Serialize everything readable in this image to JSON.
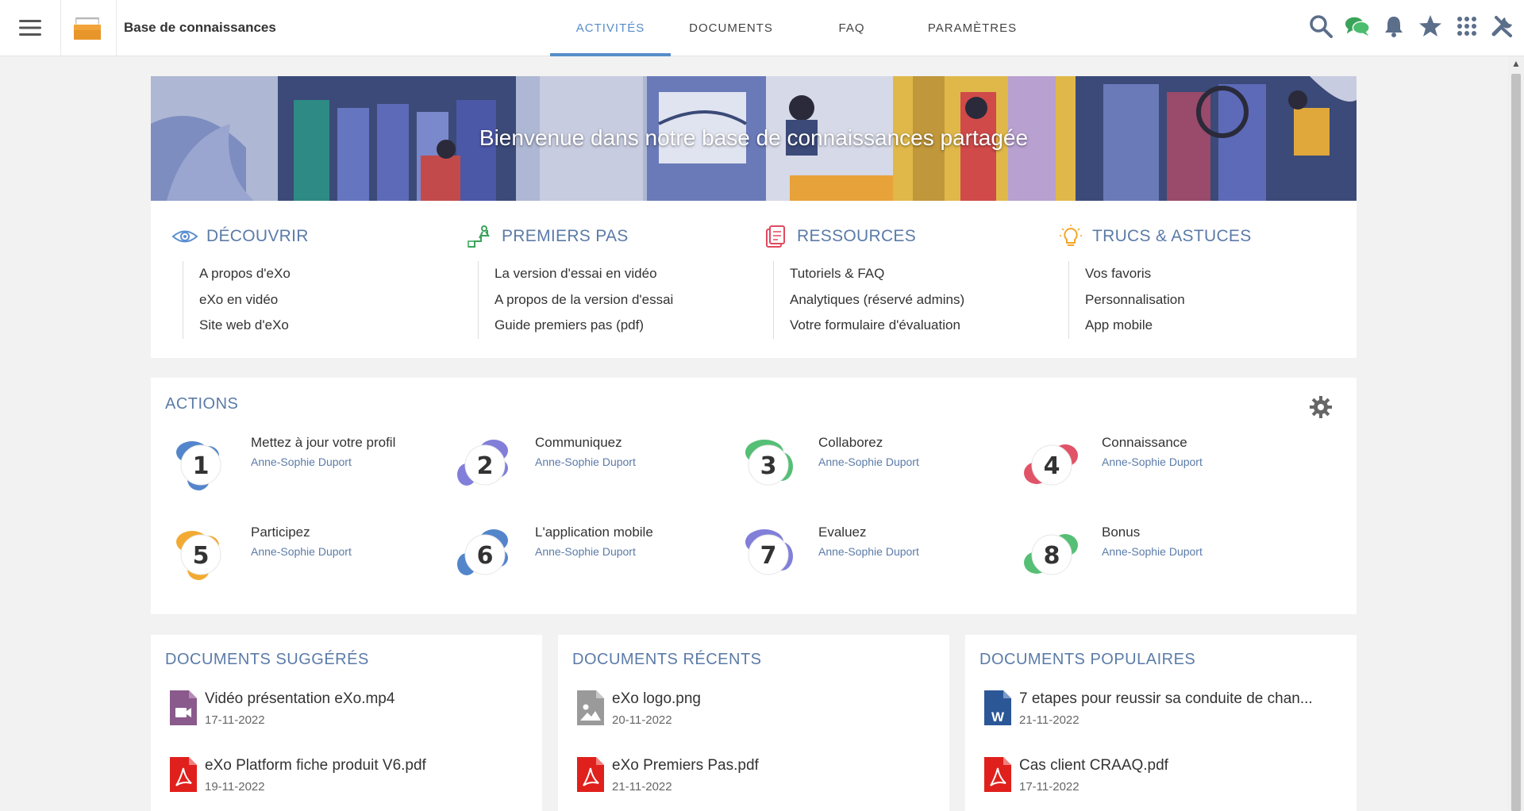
{
  "app": {
    "space_title": "Base de connaissances"
  },
  "tabs": [
    {
      "label": "ACTIVITÉS",
      "active": true
    },
    {
      "label": "DOCUMENTS",
      "active": false
    },
    {
      "label": "FAQ",
      "active": false
    },
    {
      "label": "PARAMÈTRES",
      "active": false
    }
  ],
  "top_icons": [
    "search-icon",
    "chat-icon",
    "bell-icon",
    "star-icon",
    "apps-grid-icon",
    "tools-icon"
  ],
  "banner": {
    "title": "Bienvenue dans notre base de connaissances partagée"
  },
  "link_columns": [
    {
      "title": "DÉCOUVRIR",
      "icon": "eye-icon",
      "items": [
        "A propos d'eXo",
        "eXo en vidéo",
        "Site web d'eXo"
      ]
    },
    {
      "title": "PREMIERS PAS",
      "icon": "steps-icon",
      "items": [
        "La version d'essai en vidéo",
        "A propos de la version d'essai",
        "Guide premiers pas (pdf)"
      ]
    },
    {
      "title": "RESSOURCES",
      "icon": "resources-icon",
      "items": [
        "Tutoriels & FAQ",
        "Analytiques (réservé admins)",
        "Votre formulaire d'évaluation"
      ]
    },
    {
      "title": "TRUCS & ASTUCES",
      "icon": "lightbulb-icon",
      "items": [
        "Vos favoris",
        "Personnalisation",
        "App mobile"
      ]
    }
  ],
  "actions": {
    "title": "ACTIONS",
    "items": [
      {
        "number": "1",
        "title": "Mettez à jour votre profil",
        "author": "Anne-Sophie Duport",
        "color": "#4a7fc9"
      },
      {
        "number": "2",
        "title": "Communiquez",
        "author": "Anne-Sophie Duport",
        "color": "#7b79d8"
      },
      {
        "number": "3",
        "title": "Collaborez",
        "author": "Anne-Sophie Duport",
        "color": "#4cbc6e"
      },
      {
        "number": "4",
        "title": "Connaissance",
        "author": "Anne-Sophie Duport",
        "color": "#e04a5f"
      },
      {
        "number": "5",
        "title": "Participez",
        "author": "Anne-Sophie Duport",
        "color": "#f2a628"
      },
      {
        "number": "6",
        "title": "L'application mobile",
        "author": "Anne-Sophie Duport",
        "color": "#4a7fc9"
      },
      {
        "number": "7",
        "title": "Evaluez",
        "author": "Anne-Sophie Duport",
        "color": "#7b79d8"
      },
      {
        "number": "8",
        "title": "Bonus",
        "author": "Anne-Sophie Duport",
        "color": "#4cbc6e"
      }
    ]
  },
  "documents": [
    {
      "title": "DOCUMENTS SUGGÉRÉS",
      "items": [
        {
          "name": "Vidéo présentation eXo.mp4",
          "date": "17-11-2022",
          "type": "video"
        },
        {
          "name": "eXo Platform fiche produit V6.pdf",
          "date": "19-11-2022",
          "type": "pdf"
        }
      ]
    },
    {
      "title": "DOCUMENTS RÉCENTS",
      "items": [
        {
          "name": "eXo logo.png",
          "date": "20-11-2022",
          "type": "image"
        },
        {
          "name": "eXo Premiers Pas.pdf",
          "date": "21-11-2022",
          "type": "pdf"
        }
      ]
    },
    {
      "title": "DOCUMENTS POPULAIRES",
      "items": [
        {
          "name": "7 etapes pour reussir sa conduite de chan...",
          "date": "21-11-2022",
          "type": "word"
        },
        {
          "name": "Cas client CRAAQ.pdf",
          "date": "17-11-2022",
          "type": "pdf"
        }
      ]
    }
  ],
  "colors": {
    "accent": "#578dc9",
    "section_title": "#5b7ba8",
    "pdf": "#e0201c",
    "video": "#8a5a8c",
    "image": "#9a9a9a",
    "word": "#2b5797"
  }
}
